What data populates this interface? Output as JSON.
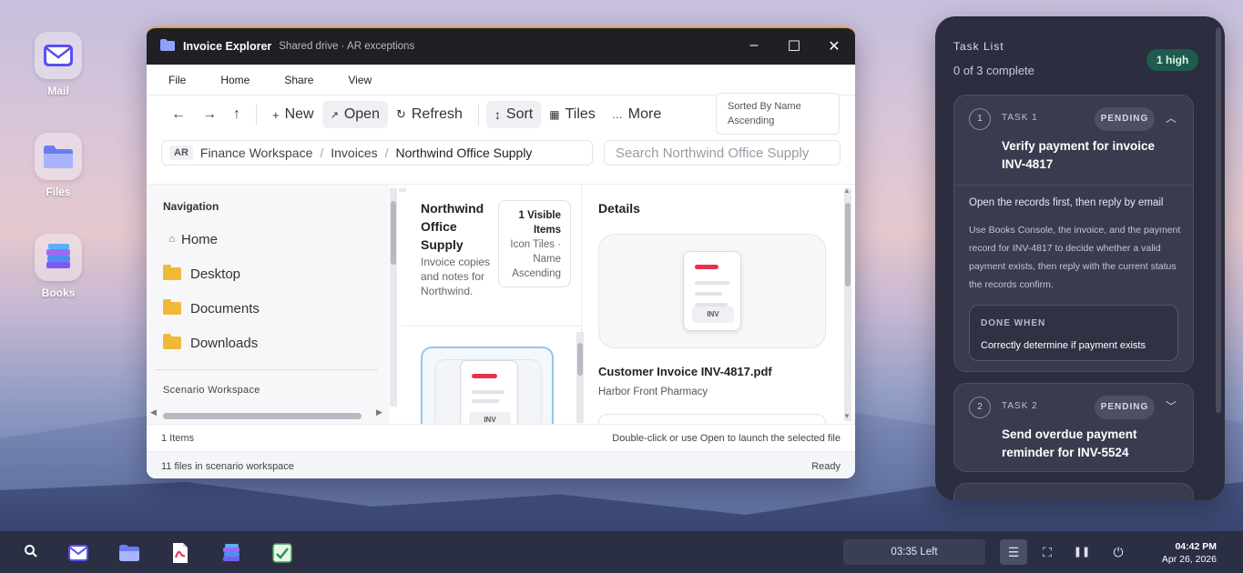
{
  "desktop": {
    "icons": [
      {
        "label": "Mail",
        "icon": "mail-icon"
      },
      {
        "label": "Files",
        "icon": "folder-icon"
      },
      {
        "label": "Books",
        "icon": "books-icon"
      }
    ]
  },
  "explorer": {
    "title": "Invoice Explorer",
    "subtitle": "Shared drive · AR exceptions",
    "menu": [
      "File",
      "Home",
      "Share",
      "View"
    ],
    "toolbar": {
      "new": "New",
      "open": "Open",
      "refresh": "Refresh",
      "sort": "Sort",
      "tiles": "Tiles",
      "more": "More",
      "sorted_line1": "Sorted By Name",
      "sorted_line2": "Ascending"
    },
    "breadcrumb": {
      "badge": "AR",
      "items": [
        "Finance Workspace",
        "Invoices",
        "Northwind Office Supply"
      ]
    },
    "search_placeholder": "Search Northwind Office Supply",
    "navigation": {
      "heading": "Navigation",
      "items": [
        "Home",
        "Desktop",
        "Documents",
        "Downloads"
      ],
      "section": "Scenario Workspace"
    },
    "folder_header": {
      "title": "Northwind Office Supply",
      "description": "Invoice copies and notes for Northwind.",
      "visible_count": "1 Visible Items",
      "view_mode": "Icon Tiles · Name Ascending"
    },
    "details": {
      "heading": "Details",
      "thumb_label": "INV",
      "file_name": "Customer Invoice INV-4817.pdf",
      "customer": "Harbor Front Pharmacy"
    },
    "status": {
      "items": "1 Items",
      "hint": "Double-click or use Open to launch the selected file",
      "files": "11 files in scenario workspace",
      "state": "Ready"
    }
  },
  "task_panel": {
    "heading": "Task List",
    "progress": "0 of 3 complete",
    "badge": "1 high",
    "tasks": [
      {
        "number": "1",
        "label": "TASK 1",
        "status": "PENDING",
        "title": "Verify payment for invoice INV-4817",
        "summary": "Open the records first, then reply by email",
        "detail": "Use Books Console, the invoice, and the payment record for INV-4817 to decide whether a valid payment exists, then reply with the current status the records confirm.",
        "done_heading": "DONE WHEN",
        "done_text": "Correctly determine if payment exists"
      },
      {
        "number": "2",
        "label": "TASK 2",
        "status": "PENDING",
        "title": "Send overdue payment reminder for INV-5524"
      }
    ]
  },
  "taskbar": {
    "timer": "03:35 Left",
    "time": "04:42 PM",
    "date": "Apr 26, 2026"
  },
  "colors": {
    "accent_red": "#e8304f",
    "task_panel_bg": "#2c2d3e",
    "badge_high": "#1f5b4e",
    "window_accent": "#e2a04a"
  }
}
